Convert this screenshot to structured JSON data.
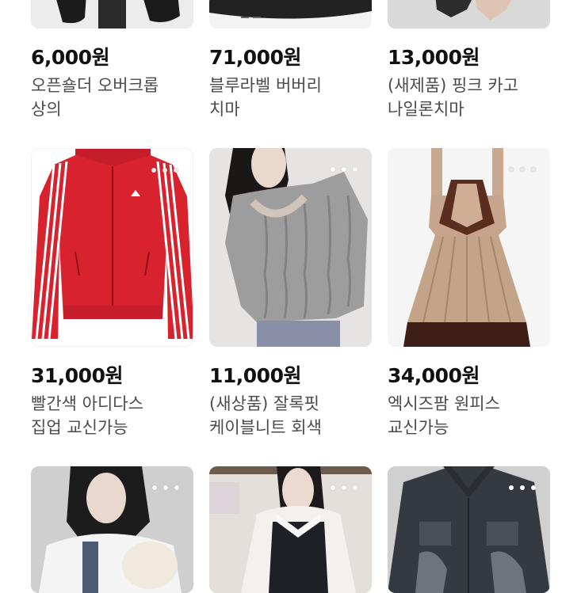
{
  "products": [
    {
      "price": "6,000원",
      "title_l1": "오픈숄더 오버크롭",
      "title_l2": "상의"
    },
    {
      "price": "71,000원",
      "title_l1": "블루라벨 버버리",
      "title_l2": "치마"
    },
    {
      "price": "13,000원",
      "title_l1": "(새제품) 핑크 카고",
      "title_l2": "나일론치마"
    },
    {
      "price": "31,000원",
      "title_l1": "빨간색 아디다스",
      "title_l2": "집업 교신가능"
    },
    {
      "price": "11,000원",
      "title_l1": "(새상품) 잘록핏",
      "title_l2": "케이블니트 회색"
    },
    {
      "price": "34,000원",
      "title_l1": "엑시즈팜 원피스",
      "title_l2": "교신가능"
    }
  ],
  "icons": {
    "more": "more-options-icon"
  }
}
